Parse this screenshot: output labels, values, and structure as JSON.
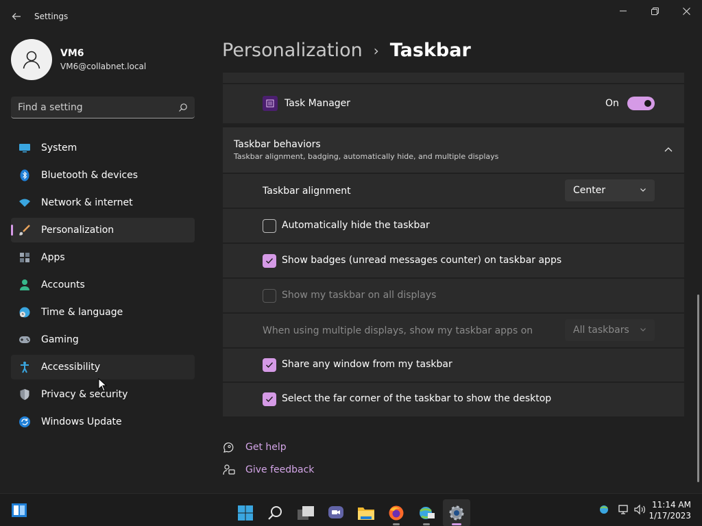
{
  "window": {
    "title": "Settings"
  },
  "profile": {
    "name": "VM6",
    "email": "VM6@collabnet.local"
  },
  "search": {
    "placeholder": "Find a setting"
  },
  "nav": [
    {
      "label": "System"
    },
    {
      "label": "Bluetooth & devices"
    },
    {
      "label": "Network & internet"
    },
    {
      "label": "Personalization"
    },
    {
      "label": "Apps"
    },
    {
      "label": "Accounts"
    },
    {
      "label": "Time & language"
    },
    {
      "label": "Gaming"
    },
    {
      "label": "Accessibility"
    },
    {
      "label": "Privacy & security"
    },
    {
      "label": "Windows Update"
    }
  ],
  "breadcrumb": {
    "parent": "Personalization",
    "separator": "›",
    "current": "Taskbar"
  },
  "task_manager": {
    "label": "Task Manager",
    "state_text": "On",
    "on": true
  },
  "behaviors": {
    "title": "Taskbar behaviors",
    "subtitle": "Taskbar alignment, badging, automatically hide, and multiple displays",
    "alignment": {
      "label": "Taskbar alignment",
      "value": "Center"
    },
    "auto_hide": {
      "label": "Automatically hide the taskbar",
      "checked": false
    },
    "badges": {
      "label": "Show badges (unread messages counter) on taskbar apps",
      "checked": true
    },
    "all_displays": {
      "label": "Show my taskbar on all displays",
      "checked": false,
      "disabled": true
    },
    "multi_display": {
      "label": "When using multiple displays, show my taskbar apps on",
      "value": "All taskbars",
      "disabled": true
    },
    "share_window": {
      "label": "Share any window from my taskbar",
      "checked": true
    },
    "far_corner": {
      "label": "Select the far corner of the taskbar to show the desktop",
      "checked": true
    }
  },
  "links": {
    "help": "Get help",
    "feedback": "Give feedback"
  },
  "clock": {
    "time": "11:14 AM",
    "date": "1/17/2023"
  },
  "colors": {
    "accent": "#d59ae6",
    "background": "#202020",
    "card": "#2b2b2b"
  }
}
